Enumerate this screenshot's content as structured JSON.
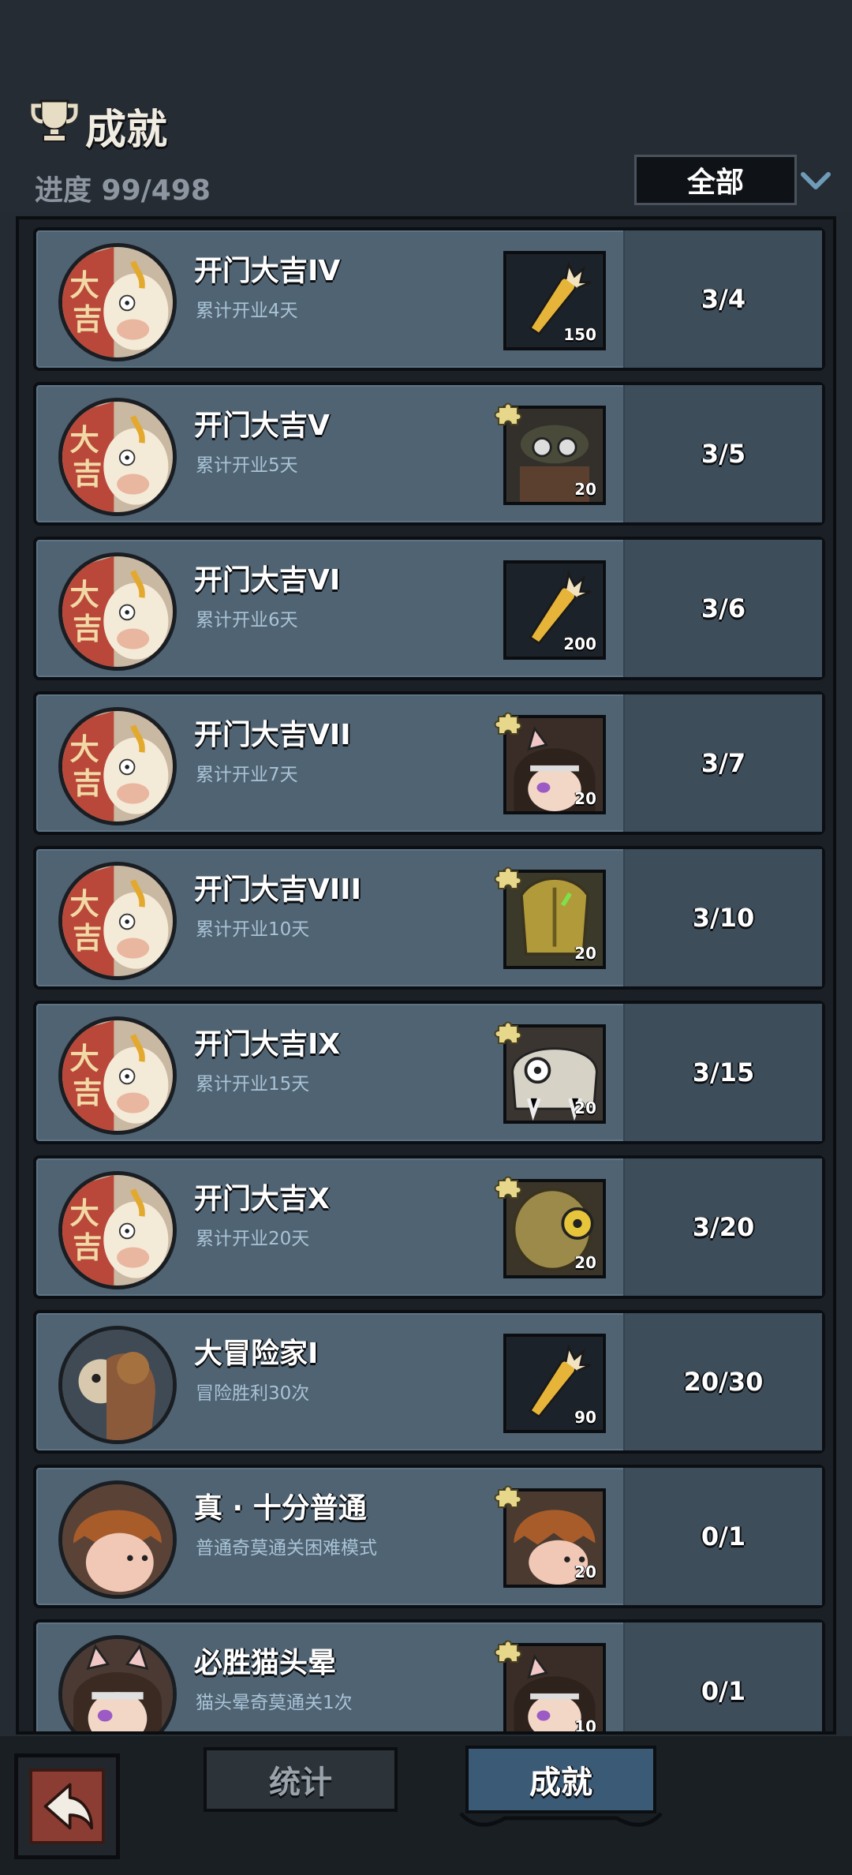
{
  "header": {
    "title": "成就",
    "progress": "进度 99/498",
    "filter": "全部"
  },
  "achievements": [
    {
      "title": "开门大吉IV",
      "desc": "累计开业4天",
      "reward": "carrot",
      "qty": "150",
      "progress": "3/4",
      "avatar": "daji"
    },
    {
      "title": "开门大吉V",
      "desc": "累计开业5天",
      "reward": "masked-hero",
      "qty": "20",
      "progress": "3/5",
      "avatar": "daji",
      "puzzle": true
    },
    {
      "title": "开门大吉VI",
      "desc": "累计开业6天",
      "reward": "carrot",
      "qty": "200",
      "progress": "3/6",
      "avatar": "daji"
    },
    {
      "title": "开门大吉VII",
      "desc": "累计开业7天",
      "reward": "cat-girl",
      "qty": "20",
      "progress": "3/7",
      "avatar": "daji",
      "puzzle": true
    },
    {
      "title": "开门大吉VIII",
      "desc": "累计开业10天",
      "reward": "golden-mask",
      "qty": "20",
      "progress": "3/10",
      "avatar": "daji",
      "puzzle": true
    },
    {
      "title": "开门大吉IX",
      "desc": "累计开业15天",
      "reward": "skull-beast",
      "qty": "20",
      "progress": "3/15",
      "avatar": "daji",
      "puzzle": true
    },
    {
      "title": "开门大吉X",
      "desc": "累计开业20天",
      "reward": "brass-robot",
      "qty": "20",
      "progress": "3/20",
      "avatar": "daji",
      "puzzle": true
    },
    {
      "title": "大冒险家I",
      "desc": "冒险胜利30次",
      "reward": "carrot",
      "qty": "90",
      "progress": "20/30",
      "avatar": "adventurer"
    },
    {
      "title": "真 · 十分普通",
      "desc": "普通奇莫通关困难模式",
      "reward": "pumpkin-kid",
      "qty": "20",
      "progress": "0/1",
      "avatar": "pumpkin",
      "puzzle": true
    },
    {
      "title": "必胜猫头晕",
      "desc": "猫头晕奇莫通关1次",
      "reward": "cat-girl",
      "qty": "10",
      "progress": "0/1",
      "avatar": "catgirl",
      "puzzle": true
    }
  ],
  "tabs": {
    "stats": "统计",
    "achievements": "成就"
  },
  "colors": {
    "row_bg": "#4f6372",
    "progress_bg": "#3d4d5a",
    "desc_text": "#a9c3d6",
    "active_tab": "#3b5a76",
    "back_button": "#8c3d33"
  }
}
